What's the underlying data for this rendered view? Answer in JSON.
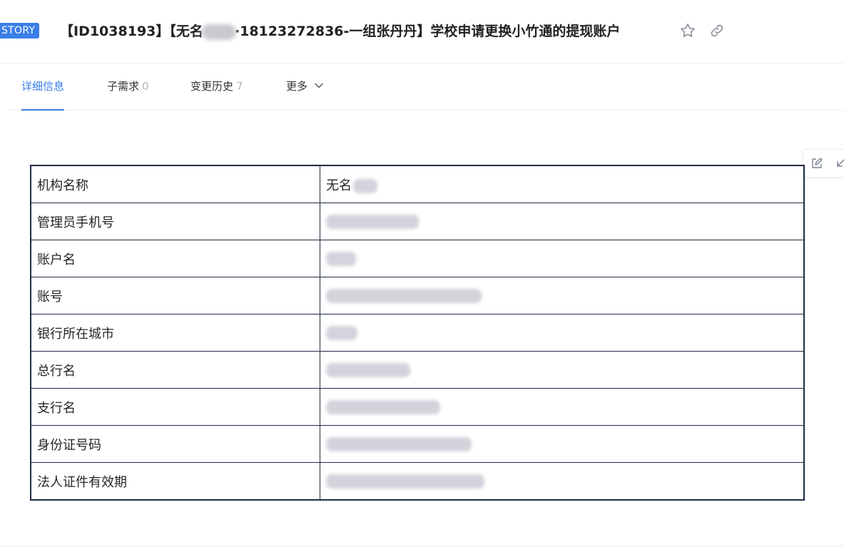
{
  "header": {
    "badge": "STORY",
    "title_prefix": "【ID1038193】【无名",
    "title_suffix": "·18123272836-一组张丹丹】学校申请更换小竹通的提现账户",
    "star_icon": "star-icon",
    "link_icon": "link-icon"
  },
  "tabs": [
    {
      "label": "详细信息",
      "count": ""
    },
    {
      "label": "子需求",
      "count": "0"
    },
    {
      "label": "变更历史",
      "count": "7"
    },
    {
      "label": "更多",
      "count": ""
    }
  ],
  "side_tools": {
    "edit_icon": "edit-icon",
    "collapse_icon": "collapse-icon"
  },
  "table": {
    "rows": [
      {
        "label": "机构名称",
        "value": "无名"
      },
      {
        "label": "管理员手机号",
        "value": ""
      },
      {
        "label": "账户名",
        "value": ""
      },
      {
        "label": "账号",
        "value": ""
      },
      {
        "label": "银行所在城市",
        "value": ""
      },
      {
        "label": "总行名",
        "value": ""
      },
      {
        "label": "支行名",
        "value": ""
      },
      {
        "label": "身份证号码",
        "value": ""
      },
      {
        "label": "法人证件有效期",
        "value": ""
      }
    ]
  },
  "colors": {
    "accent": "#3a7ee8",
    "table_border": "#1f2a44"
  }
}
